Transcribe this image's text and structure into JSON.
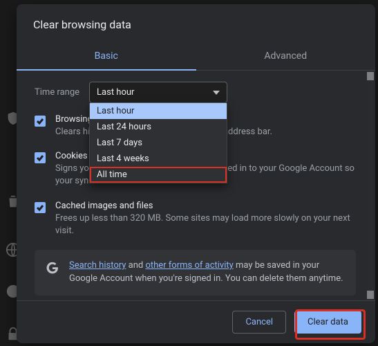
{
  "dialog": {
    "title": "Clear browsing data",
    "tabs": {
      "basic": "Basic",
      "advanced": "Advanced"
    },
    "range_label": "Time range",
    "select": {
      "value": "Last hour",
      "options": [
        "Last hour",
        "Last 24 hours",
        "Last 7 days",
        "Last 4 weeks",
        "All time"
      ]
    },
    "items": [
      {
        "title": "Browsing history",
        "desc": "Clears history and autocompletions in the address bar."
      },
      {
        "title": "Cookies and other site data",
        "desc": "Signs you out of most sites. You'll stay signed in to your Google Account so your synced data can be cleared."
      },
      {
        "title": "Cached images and files",
        "desc": "Frees up less than 320 MB. Some sites may load more slowly on your next visit."
      }
    ],
    "info": {
      "link1": "Search history",
      "mid1": " and ",
      "link2": "other forms of activity",
      "tail": " may be saved in your Google Account when you're signed in. You can delete them anytime."
    },
    "buttons": {
      "cancel": "Cancel",
      "clear": "Clear data"
    }
  }
}
